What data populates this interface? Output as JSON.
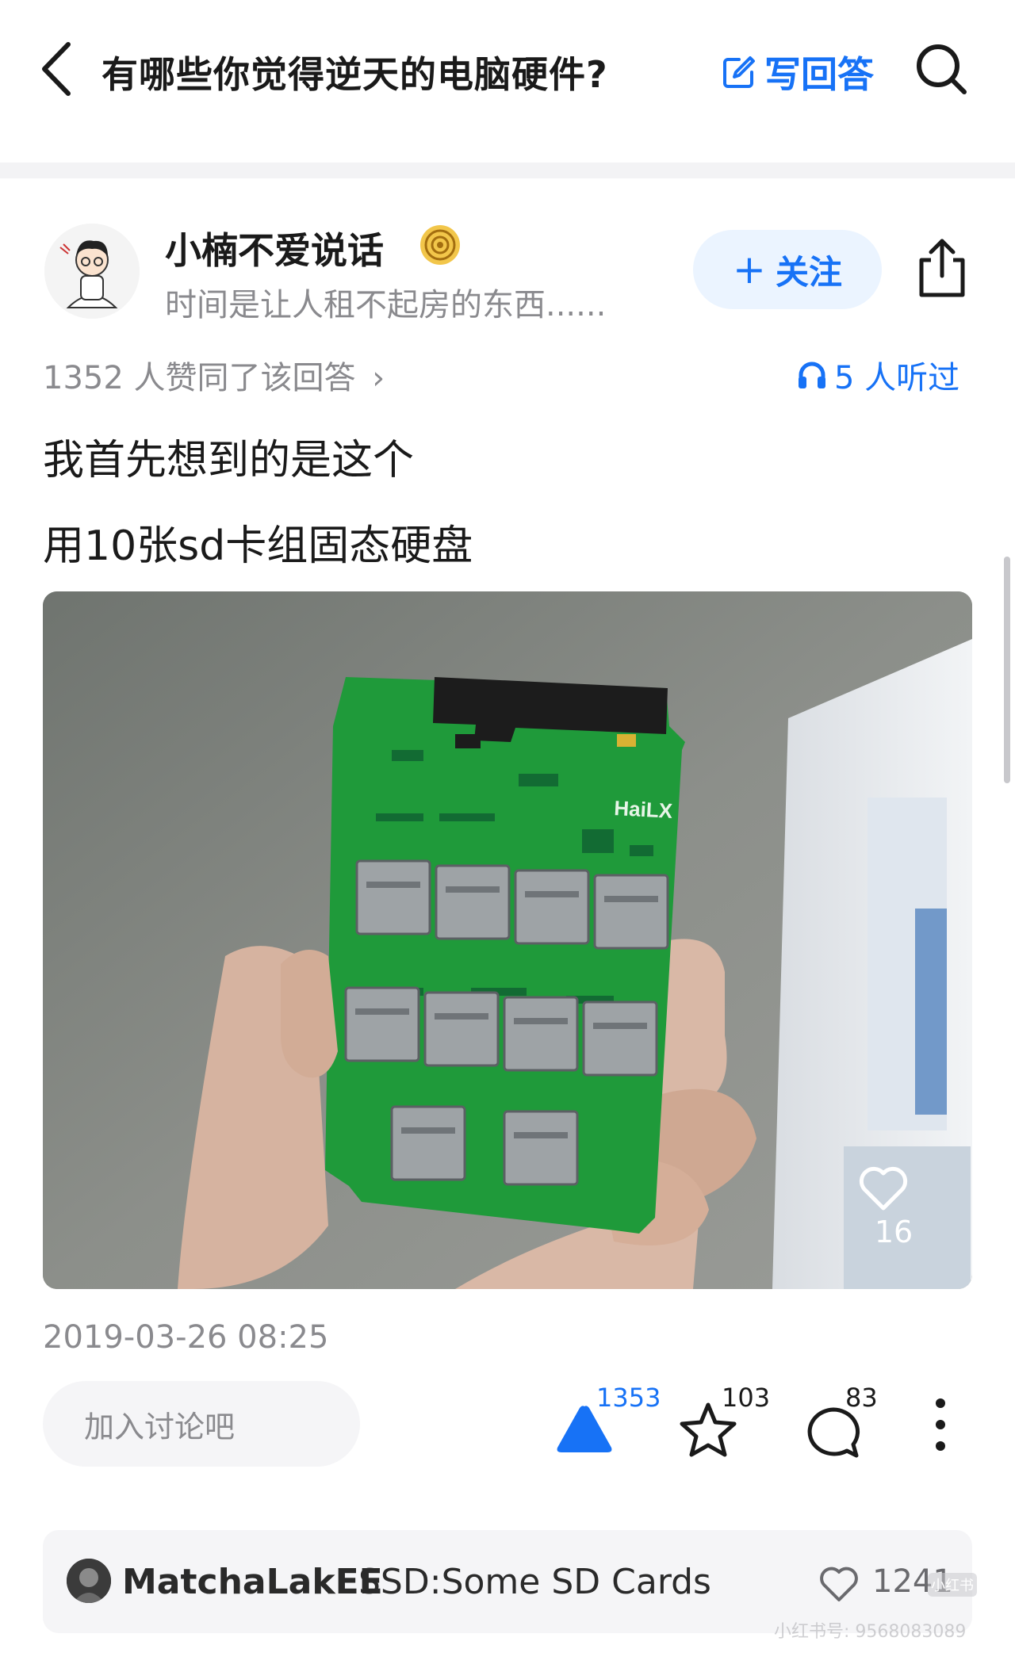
{
  "header": {
    "question_title": "有哪些你觉得逆天的电脑硬件?",
    "write_answer_label": "写回答"
  },
  "author": {
    "name": "小楠不爱说话",
    "bio": "时间是让人租不起房的东西......",
    "follow_label": "关注",
    "follow_plus": "+"
  },
  "stats": {
    "agree_text": "1352 人赞同了该回答",
    "agree_chevron": "›",
    "listened_text": "5 人听过"
  },
  "answer": {
    "paragraphs": [
      "我首先想到的是这个",
      "用10张sd卡组固态硬盘"
    ],
    "image_like_count": "16",
    "board_label": "HaiLX",
    "date": "2019-03-26 08:25"
  },
  "actions": {
    "discuss_placeholder": "加入讨论吧",
    "vote_count": "1353",
    "favorite_count": "103",
    "comment_count": "83"
  },
  "featured_comment": {
    "user": "MatchaLakEE",
    "text": "SSD:Some SD Cards",
    "like_count": "1241"
  },
  "watermark": {
    "logo_text": "小红书",
    "text": "小红书号: 9568083089"
  },
  "colors": {
    "accent": "#1772f6",
    "follow_bg": "#ebf4ff",
    "muted_text": "#8a8a8e",
    "pcb_green": "#1f9a3a"
  },
  "icons": [
    "back-chevron-icon",
    "edit-icon",
    "search-icon",
    "share-icon",
    "headphones-icon",
    "heart-icon",
    "upvote-triangle-icon",
    "star-icon",
    "comment-bubble-icon",
    "more-vertical-icon"
  ]
}
